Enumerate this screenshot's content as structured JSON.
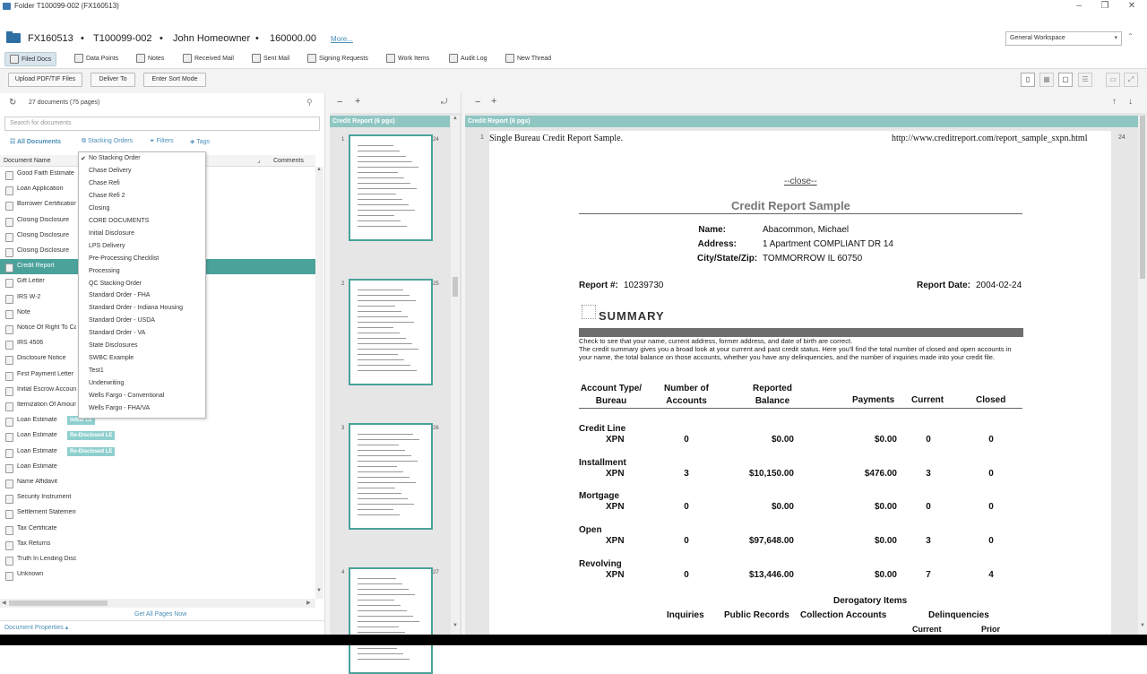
{
  "window": {
    "title": "Folder T100099-002 (FX160513)"
  },
  "header": {
    "folder_id": "FX160513",
    "loan_id": "T100099-002",
    "borrower": "John Homeowner",
    "amount": "160000.00",
    "more_link": "More...",
    "workspace": "General Workspace",
    "sep": "•"
  },
  "tabs": [
    {
      "label": "Filed Docs"
    },
    {
      "label": "Data Points"
    },
    {
      "label": "Notes"
    },
    {
      "label": "Received Mail"
    },
    {
      "label": "Sent Mail"
    },
    {
      "label": "Signing Requests"
    },
    {
      "label": "Work Items"
    },
    {
      "label": "Audit Log"
    },
    {
      "label": "New Thread"
    }
  ],
  "toolbar": {
    "upload": "Upload PDF/TIF Files",
    "deliver": "Deliver To",
    "sort": "Enter Sort Mode"
  },
  "left": {
    "doc_count": "27 documents (75 pages)",
    "search_placeholder": "Search for documents",
    "filters": {
      "all": "All Documents",
      "stacking": "Stacking Orders",
      "filters": "Filters",
      "tags": "Tags"
    },
    "col_name": "Document Name",
    "col_comments": "Comments",
    "get_all_pages": "Get All Pages Now",
    "doc_props": "Document Properties ▴",
    "documents": [
      {
        "name": "Good Faith Estimate",
        "badge": ""
      },
      {
        "name": "Loan Application",
        "badge": ""
      },
      {
        "name": "Borrower Certification",
        "badge": ""
      },
      {
        "name": "Closing Disclosure",
        "badge": ""
      },
      {
        "name": "Closing Disclosure",
        "badge": ""
      },
      {
        "name": "Closing Disclosure",
        "badge": ""
      },
      {
        "name": "Credit Report",
        "badge": ""
      },
      {
        "name": "Gift Letter",
        "badge": ""
      },
      {
        "name": "IRS W-2",
        "badge": ""
      },
      {
        "name": "Note",
        "badge": ""
      },
      {
        "name": "Notice Of Right To Cancel",
        "badge": ""
      },
      {
        "name": "IRS 4506",
        "badge": ""
      },
      {
        "name": "Disclosure Notice",
        "badge": ""
      },
      {
        "name": "First Payment Letter",
        "badge": ""
      },
      {
        "name": "Initial Escrow Account",
        "badge": ""
      },
      {
        "name": "Itemization Of Amount",
        "badge": ""
      },
      {
        "name": "Loan Estimate",
        "badge": "Initial LE"
      },
      {
        "name": "Loan Estimate",
        "badge": "Re-Disclosed LE"
      },
      {
        "name": "Loan Estimate",
        "badge": "Re-Disclosed LE"
      },
      {
        "name": "Loan Estimate",
        "badge": ""
      },
      {
        "name": "Name Affidavit",
        "badge": ""
      },
      {
        "name": "Security Instrument",
        "badge": ""
      },
      {
        "name": "Settlement Statement",
        "badge": ""
      },
      {
        "name": "Tax Certificate",
        "badge": ""
      },
      {
        "name": "Tax Returns",
        "badge": ""
      },
      {
        "name": "Truth In Lending Disclosure",
        "badge": ""
      },
      {
        "name": "Unknown",
        "badge": ""
      }
    ],
    "stacking_orders": [
      "No Stacking Order",
      "Chase Delivery",
      "Chase Refi",
      "Chase Refi 2",
      "Closing",
      "CORE DOCUMENTS",
      "Initial Disclosure",
      "LPS Delivery",
      "Pre-Processing Checklist",
      "Processing",
      "QC Stacking Order",
      "Standard Order - FHA",
      "Standard Order - Indiana Housing",
      "Standard Order - USDA",
      "Standard Order - VA",
      "State Disclosures",
      "SWBC Example",
      "Test1",
      "Underwriting",
      "Wells Fargo - Conventional",
      "Wells Fargo - FHA/VA"
    ]
  },
  "middle": {
    "header": "Credit Report (6 pgs)",
    "thumbs": [
      {
        "page": "1",
        "total": "24"
      },
      {
        "page": "2",
        "total": "25"
      },
      {
        "page": "3",
        "total": "26"
      },
      {
        "page": "4",
        "total": "27"
      }
    ]
  },
  "viewer": {
    "header": "Credit Report (6 pgs)",
    "page_num": "1",
    "page_total": "24",
    "doc_header_left": "Single Bureau Credit Report Sample.",
    "doc_header_right": "http://www.creditreport.com/report_sample_sxpn.html",
    "close_link": "--close--",
    "title": "Credit Report Sample",
    "name_label": "Name:",
    "name": "Abacommon, Michael",
    "address_label": "Address:",
    "address": "1 Apartment  COMPLIANT  DR  14",
    "city_label": "City/State/Zip:",
    "city": "TOMMORROW  IL  60750",
    "report_no_label": "Report #:",
    "report_no": "10239730",
    "report_date_label": "Report Date:",
    "report_date": "2004-02-24",
    "summary_label": "SUMMARY",
    "intro": "Check to see that your name, current address, former address, and date of birth are correct.",
    "intro2": "The credit summary gives you a broad look at your current and past credit status. Here you'll find the total number of closed and open accounts in your name, the total balance on those accounts, whether you have any delinquencies, and the number of inquiries made into your credit file.",
    "col_type": "Account Type/",
    "col_type2": "Bureau",
    "col_num": "Number of",
    "col_num2": "Accounts",
    "col_bal": "Reported",
    "col_bal2": "Balance",
    "col_pay": "Payments",
    "col_cur": "Current",
    "col_closed": "Closed",
    "rows": [
      {
        "type": "Credit Line",
        "bureau": "XPN",
        "num": "0",
        "bal": "$0.00",
        "pay": "$0.00",
        "cur": "0",
        "closed": "0"
      },
      {
        "type": "Installment",
        "bureau": "XPN",
        "num": "3",
        "bal": "$10,150.00",
        "pay": "$476.00",
        "cur": "3",
        "closed": "0"
      },
      {
        "type": "Mortgage",
        "bureau": "XPN",
        "num": "0",
        "bal": "$0.00",
        "pay": "$0.00",
        "cur": "0",
        "closed": "0"
      },
      {
        "type": "Open",
        "bureau": "XPN",
        "num": "0",
        "bal": "$97,648.00",
        "pay": "$0.00",
        "cur": "3",
        "closed": "0"
      },
      {
        "type": "Revolving",
        "bureau": "XPN",
        "num": "0",
        "bal": "$13,446.00",
        "pay": "$0.00",
        "cur": "7",
        "closed": "4"
      }
    ],
    "derog_title": "Derogatory Items",
    "derog_inq": "Inquiries",
    "derog_pub": "Public Records",
    "derog_col": "Collection Accounts",
    "derog_del": "Delinquencies",
    "derog_current": "Current",
    "derog_prior": "Prior"
  }
}
